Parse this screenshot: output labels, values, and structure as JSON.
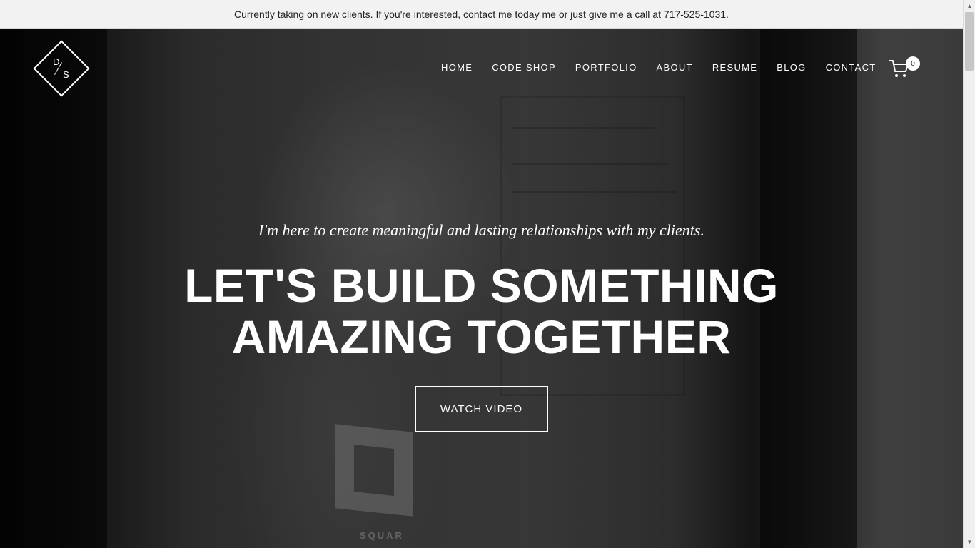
{
  "announcement": {
    "text": "Currently taking on new clients. If you're interested, contact me today me or just give me a call at 717-525-1031."
  },
  "logo": {
    "line1": "D",
    "line2": "S"
  },
  "nav": {
    "items": [
      {
        "label": "HOME"
      },
      {
        "label": "CODE SHOP"
      },
      {
        "label": "PORTFOLIO"
      },
      {
        "label": "ABOUT"
      },
      {
        "label": "RESUME"
      },
      {
        "label": "BLOG"
      },
      {
        "label": "CONTACT"
      }
    ],
    "cart_count": "0"
  },
  "hero": {
    "tagline": "I'm here to create meaningful and lasting relationships with my clients.",
    "headline_line1": "LET'S BUILD SOMETHING",
    "headline_line2": "AMAZING TOGETHER",
    "cta_label": "WATCH VIDEO",
    "shirt_text": "SQUAR"
  },
  "colors": {
    "announce_bg": "#f2f2f2",
    "text_on_hero": "#ffffff"
  }
}
